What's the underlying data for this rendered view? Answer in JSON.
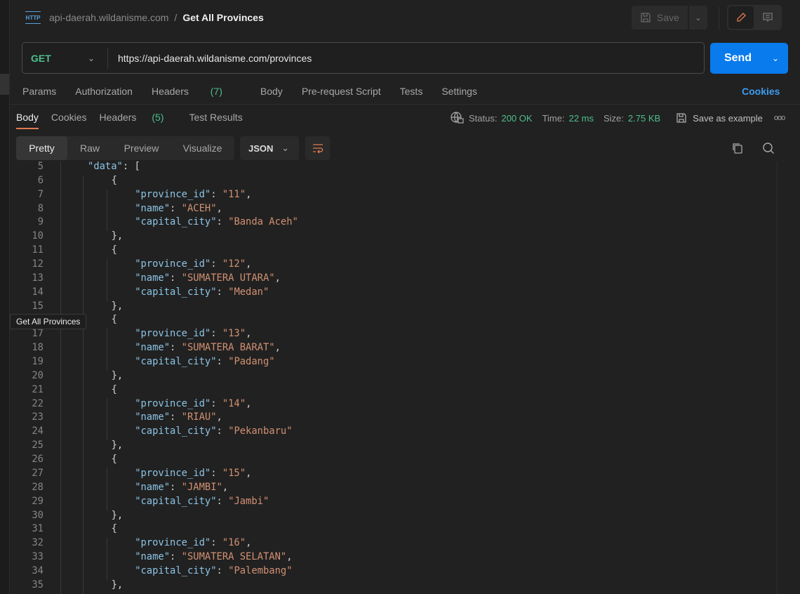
{
  "header": {
    "collection": "api-daerah.wildanisme.com",
    "separator": "/",
    "title": "Get All Provinces",
    "http_icon": "HTTP",
    "save_label": "Save"
  },
  "request": {
    "method": "GET",
    "url": "https://api-daerah.wildanisme.com/provinces",
    "send_label": "Send"
  },
  "request_tabs": [
    {
      "label": "Params"
    },
    {
      "label": "Authorization"
    },
    {
      "label": "Headers",
      "count": "(7)"
    },
    {
      "label": "Body"
    },
    {
      "label": "Pre-request Script"
    },
    {
      "label": "Tests"
    },
    {
      "label": "Settings"
    }
  ],
  "cookies_link": "Cookies",
  "response_tabs": [
    {
      "label": "Body",
      "active": true
    },
    {
      "label": "Cookies"
    },
    {
      "label": "Headers",
      "count": "(5)"
    },
    {
      "label": "Test Results"
    }
  ],
  "response_meta": {
    "status_label": "Status:",
    "status": "200 OK",
    "time_label": "Time:",
    "time": "22 ms",
    "size_label": "Size:",
    "size": "2.75 KB",
    "save_example": "Save as example",
    "more": "ooo"
  },
  "view_modes": [
    "Pretty",
    "Raw",
    "Preview",
    "Visualize"
  ],
  "format": "JSON",
  "tooltip": "Get All Provinces",
  "colors": {
    "accent": "#e07a52",
    "send": "#097bed",
    "success": "#4dbf8c",
    "link": "#3d9df0",
    "key": "#8cc4e6",
    "string": "#d29173"
  },
  "code_lines": [
    {
      "n": "5",
      "indent": 1,
      "key": "data",
      "open": "["
    },
    {
      "n": "6",
      "indent": 2,
      "text": "{"
    },
    {
      "n": "7",
      "indent": 3,
      "key": "province_id",
      "val": "11",
      "comma": true
    },
    {
      "n": "8",
      "indent": 3,
      "key": "name",
      "val": "ACEH",
      "comma": true
    },
    {
      "n": "9",
      "indent": 3,
      "key": "capital_city",
      "val": "Banda Aceh"
    },
    {
      "n": "10",
      "indent": 2,
      "text": "},"
    },
    {
      "n": "11",
      "indent": 2,
      "text": "{"
    },
    {
      "n": "12",
      "indent": 3,
      "key": "province_id",
      "val": "12",
      "comma": true
    },
    {
      "n": "13",
      "indent": 3,
      "key": "name",
      "val": "SUMATERA UTARA",
      "comma": true
    },
    {
      "n": "14",
      "indent": 3,
      "key": "capital_city",
      "val": "Medan"
    },
    {
      "n": "15",
      "indent": 2,
      "text": "},"
    },
    {
      "n": "16",
      "indent": 2,
      "text": "{"
    },
    {
      "n": "17",
      "indent": 3,
      "key": "province_id",
      "val": "13",
      "comma": true
    },
    {
      "n": "18",
      "indent": 3,
      "key": "name",
      "val": "SUMATERA BARAT",
      "comma": true
    },
    {
      "n": "19",
      "indent": 3,
      "key": "capital_city",
      "val": "Padang"
    },
    {
      "n": "20",
      "indent": 2,
      "text": "},"
    },
    {
      "n": "21",
      "indent": 2,
      "text": "{"
    },
    {
      "n": "22",
      "indent": 3,
      "key": "province_id",
      "val": "14",
      "comma": true
    },
    {
      "n": "23",
      "indent": 3,
      "key": "name",
      "val": "RIAU",
      "comma": true
    },
    {
      "n": "24",
      "indent": 3,
      "key": "capital_city",
      "val": "Pekanbaru"
    },
    {
      "n": "25",
      "indent": 2,
      "text": "},"
    },
    {
      "n": "26",
      "indent": 2,
      "text": "{"
    },
    {
      "n": "27",
      "indent": 3,
      "key": "province_id",
      "val": "15",
      "comma": true
    },
    {
      "n": "28",
      "indent": 3,
      "key": "name",
      "val": "JAMBI",
      "comma": true
    },
    {
      "n": "29",
      "indent": 3,
      "key": "capital_city",
      "val": "Jambi"
    },
    {
      "n": "30",
      "indent": 2,
      "text": "},"
    },
    {
      "n": "31",
      "indent": 2,
      "text": "{"
    },
    {
      "n": "32",
      "indent": 3,
      "key": "province_id",
      "val": "16",
      "comma": true
    },
    {
      "n": "33",
      "indent": 3,
      "key": "name",
      "val": "SUMATERA SELATAN",
      "comma": true
    },
    {
      "n": "34",
      "indent": 3,
      "key": "capital_city",
      "val": "Palembang"
    },
    {
      "n": "35",
      "indent": 2,
      "text": "},"
    }
  ]
}
